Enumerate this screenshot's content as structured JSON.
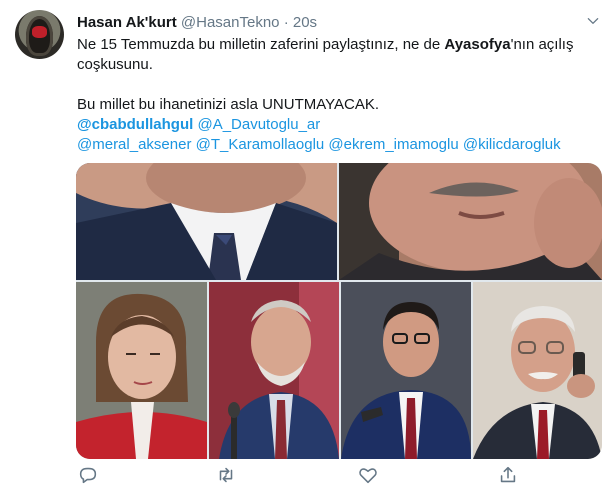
{
  "author": {
    "name": "Hasan Ak'kurt",
    "handle": "@HasanTekno",
    "separator": "·",
    "time": "20s"
  },
  "tweet": {
    "line1_start": "Ne 15 Temmuzda bu milletin zaferini paylaştınız, ne de ",
    "line1_bold": "Ayasofya",
    "line1_end": "'nın açılış coşkusunu.",
    "line2": "Bu millet bu ihanetinizi asla UNUTMAYACAK.",
    "mentions": [
      "@cbabdullahgul",
      "@A_Davutoglu_ar",
      "@meral_aksener",
      "@T_Karamollaoglu",
      "@ekrem_imamoglu",
      "@kilicdarogluk"
    ]
  },
  "icons": {
    "caret": "chevron-down-icon",
    "reply": "reply-icon",
    "retweet": "retweet-icon",
    "like": "like-icon",
    "share": "share-icon"
  },
  "colors": {
    "link": "#1b95e0",
    "secondary_text": "#657786",
    "primary_text": "#14171a"
  }
}
